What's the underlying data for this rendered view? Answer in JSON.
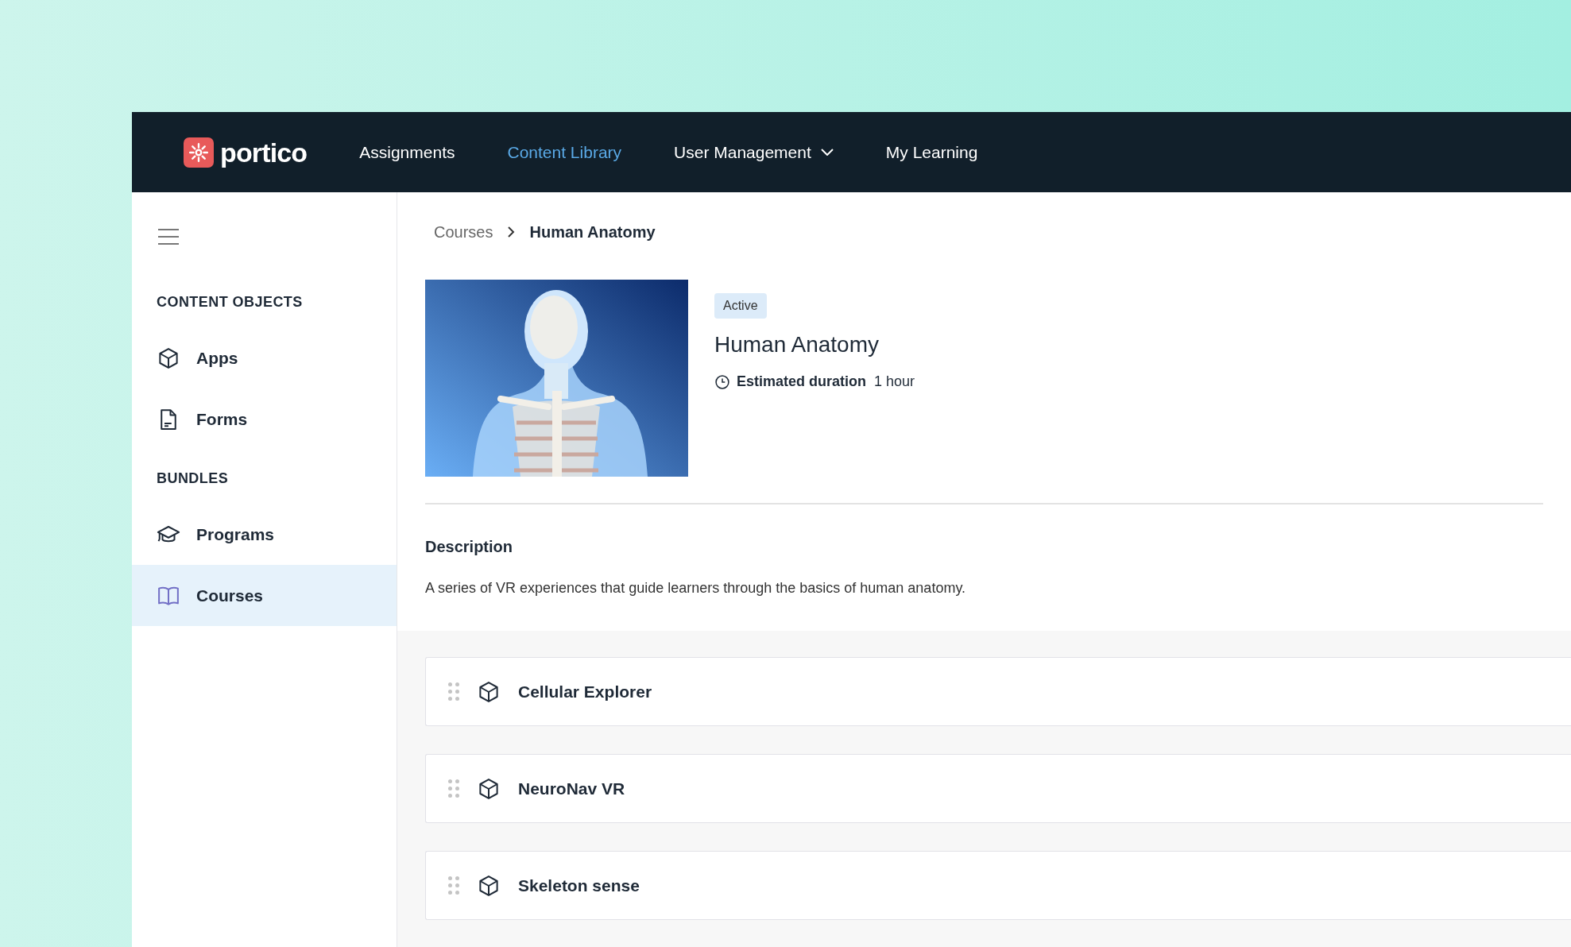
{
  "header": {
    "logo": "portico",
    "nav": [
      {
        "label": "Assignments",
        "kind": "link",
        "selected": false
      },
      {
        "label": "Content Library",
        "kind": "link",
        "selected": true
      },
      {
        "label": "User Management",
        "kind": "dropdown",
        "selected": false
      },
      {
        "label": "My Learning",
        "kind": "link",
        "selected": false
      }
    ]
  },
  "sidebar": {
    "sections": [
      {
        "heading": "CONTENT OBJECTS",
        "items": [
          {
            "label": "Apps",
            "selected": false
          },
          {
            "label": "Forms",
            "selected": false
          }
        ]
      },
      {
        "heading": "BUNDLES",
        "items": [
          {
            "label": "Programs",
            "selected": false
          },
          {
            "label": "Courses",
            "selected": true
          }
        ]
      }
    ]
  },
  "breadcrumb": [
    "Courses",
    "Human Anatomy"
  ],
  "course": {
    "status": "Active",
    "title": "Human Anatomy",
    "duration_label": "Estimated duration",
    "duration": "1 hour"
  },
  "description": {
    "heading": "Description",
    "text": "A series of VR experiences that guide learners through the basics of human anatomy."
  },
  "items": [
    {
      "title": "Cellular Explorer"
    },
    {
      "title": "NeuroNav VR"
    },
    {
      "title": "Skeleton sense"
    }
  ]
}
